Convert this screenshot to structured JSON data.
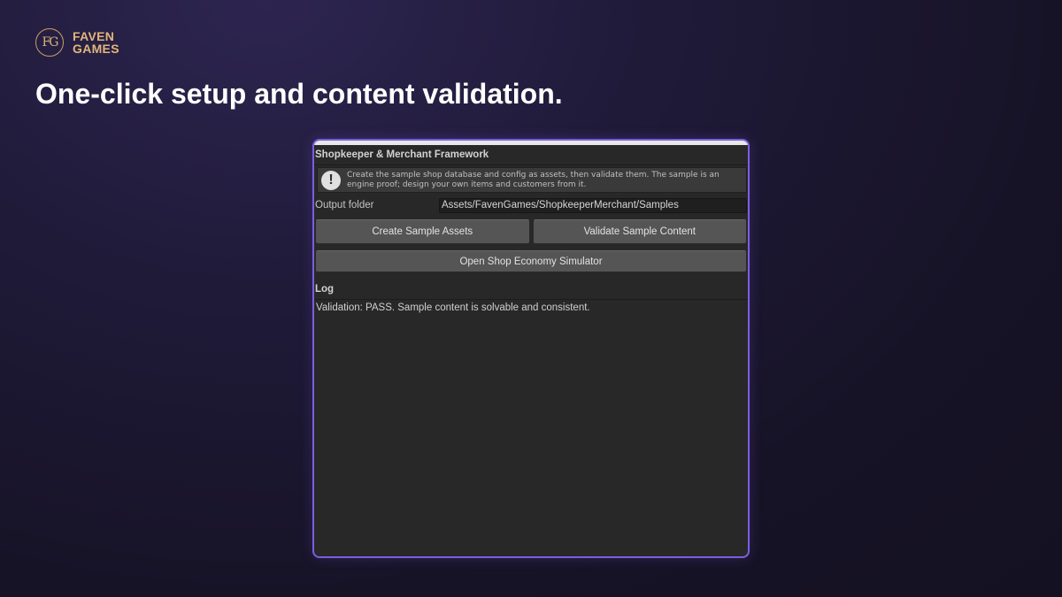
{
  "brand": {
    "monogram": "FG",
    "name_line1": "FAVEN",
    "name_line2": "GAMES"
  },
  "headline": "One-click setup and content validation.",
  "window": {
    "title": "Shopkeeper & Merchant Framework",
    "help_icon": "!",
    "help_text": "Create the sample shop database and config as assets, then validate them. The sample is an engine proof; design your own items and customers from it.",
    "output_folder_label": "Output folder",
    "output_folder_value": "Assets/FavenGames/ShopkeeperMerchant/Samples",
    "create_button": "Create Sample Assets",
    "validate_button": "Validate Sample Content",
    "simulator_button": "Open Shop Economy Simulator",
    "log_title": "Log",
    "log_text": "Validation: PASS. Sample content is solvable and consistent."
  },
  "colors": {
    "accent": "#7b5ee0",
    "brand_gold": "#e3b57a",
    "panel_bg": "#282828"
  },
  "icons": {
    "logo": "fg-monogram-icon",
    "help": "exclamation-info-icon"
  }
}
